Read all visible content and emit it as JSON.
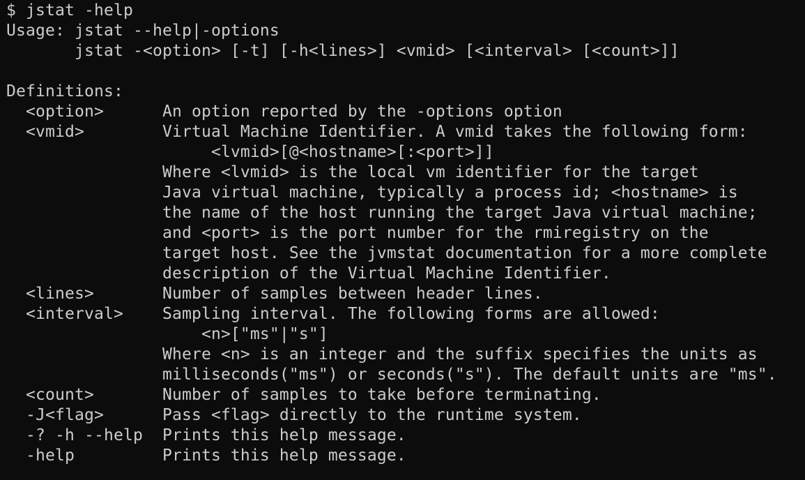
{
  "terminal": {
    "lines": [
      "$ jstat -help",
      "Usage: jstat --help|-options",
      "       jstat -<option> [-t] [-h<lines>] <vmid> [<interval> [<count>]]",
      "",
      "Definitions:",
      "  <option>      An option reported by the -options option",
      "  <vmid>        Virtual Machine Identifier. A vmid takes the following form:",
      "                     <lvmid>[@<hostname>[:<port>]]",
      "                Where <lvmid> is the local vm identifier for the target",
      "                Java virtual machine, typically a process id; <hostname> is",
      "                the name of the host running the target Java virtual machine;",
      "                and <port> is the port number for the rmiregistry on the",
      "                target host. See the jvmstat documentation for a more complete",
      "                description of the Virtual Machine Identifier.",
      "  <lines>       Number of samples between header lines.",
      "  <interval>    Sampling interval. The following forms are allowed:",
      "                    <n>[\"ms\"|\"s\"]",
      "                Where <n> is an integer and the suffix specifies the units as",
      "                milliseconds(\"ms\") or seconds(\"s\"). The default units are \"ms\".",
      "  <count>       Number of samples to take before terminating.",
      "  -J<flag>      Pass <flag> directly to the runtime system.",
      "  -? -h --help  Prints this help message.",
      "  -help         Prints this help message."
    ]
  }
}
